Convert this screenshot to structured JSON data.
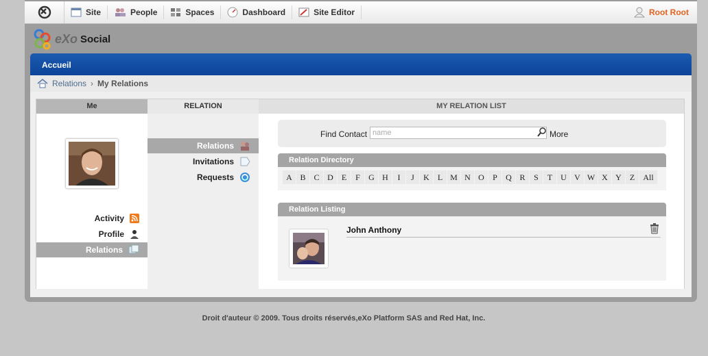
{
  "toolbar": {
    "items": [
      {
        "label": "Site",
        "icon": "site-icon"
      },
      {
        "label": "People",
        "icon": "people-icon"
      },
      {
        "label": "Spaces",
        "icon": "spaces-icon"
      },
      {
        "label": "Dashboard",
        "icon": "dashboard-icon"
      },
      {
        "label": "Site Editor",
        "icon": "site-editor-icon"
      }
    ],
    "user": "Root Root",
    "user_color": "#e5621e"
  },
  "brand": {
    "name_a": "eXo",
    "name_b": "Social"
  },
  "nav": {
    "title": "Accueil",
    "color": "#0c449a"
  },
  "breadcrumb": {
    "root": "Relations",
    "current": "My Relations"
  },
  "columns": {
    "me": "Me",
    "relation": "RELATION",
    "list": "MY RELATION LIST"
  },
  "me_menu": [
    {
      "label": "Activity",
      "icon": "rss-icon"
    },
    {
      "label": "Profile",
      "icon": "profile-icon"
    },
    {
      "label": "Relations",
      "icon": "relations-icon",
      "active": true
    }
  ],
  "relation_menu": [
    {
      "label": "Relations",
      "icon": "relations-people-icon",
      "active": true
    },
    {
      "label": "Invitations",
      "icon": "invitation-icon"
    },
    {
      "label": "Requests",
      "icon": "requests-icon"
    }
  ],
  "find": {
    "label": "Find Contact :",
    "placeholder": "name",
    "more": "More"
  },
  "directory": {
    "title": "Relation Directory",
    "letters": [
      "A",
      "B",
      "C",
      "D",
      "E",
      "F",
      "G",
      "H",
      "I",
      "J",
      "K",
      "L",
      "M",
      "N",
      "O",
      "P",
      "Q",
      "R",
      "S",
      "T",
      "U",
      "V",
      "W",
      "X",
      "Y",
      "Z",
      "All"
    ]
  },
  "listing": {
    "title": "Relation Listing",
    "contacts": [
      {
        "name": "John Anthony"
      }
    ]
  },
  "footer": "Droit d'auteur © 2009. Tous droits réservés,eXo Platform SAS and Red Hat, Inc."
}
